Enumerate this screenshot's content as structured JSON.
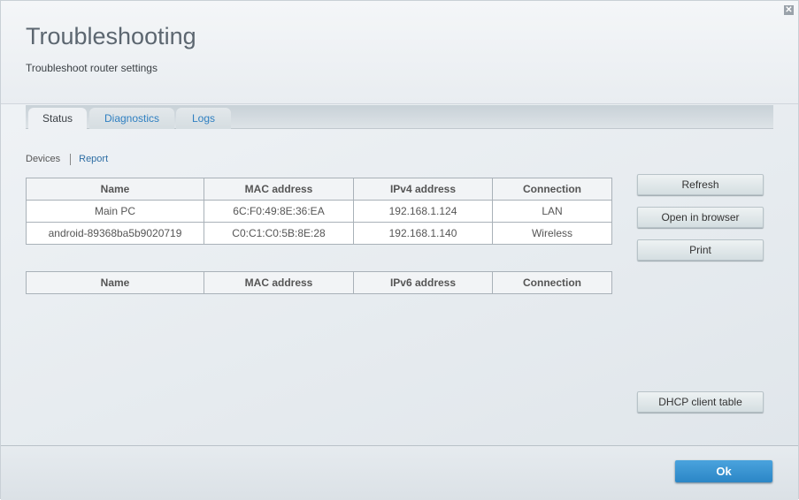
{
  "header": {
    "title": "Troubleshooting",
    "subtitle": "Troubleshoot router settings"
  },
  "tabs": [
    {
      "label": "Status"
    },
    {
      "label": "Diagnostics"
    },
    {
      "label": "Logs"
    }
  ],
  "sublinks": {
    "devices": "Devices",
    "report": "Report"
  },
  "ipv4_table": {
    "headers": [
      "Name",
      "MAC address",
      "IPv4 address",
      "Connection"
    ],
    "rows": [
      [
        "Main PC",
        "6C:F0:49:8E:36:EA",
        "192.168.1.124",
        "LAN"
      ],
      [
        "android-89368ba5b9020719",
        "C0:C1:C0:5B:8E:28",
        "192.168.1.140",
        "Wireless"
      ]
    ]
  },
  "ipv6_table": {
    "headers": [
      "Name",
      "MAC address",
      "IPv6 address",
      "Connection"
    ]
  },
  "buttons": {
    "refresh": "Refresh",
    "open_browser": "Open in browser",
    "print": "Print",
    "dhcp": "DHCP client table",
    "ok": "Ok"
  },
  "close_glyph": "✕"
}
